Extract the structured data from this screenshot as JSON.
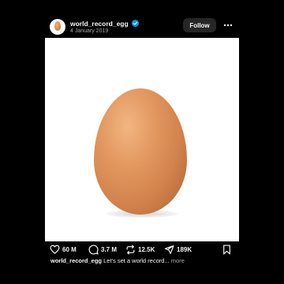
{
  "post": {
    "username": "world_record_egg",
    "date": "4 January 2019",
    "follow_label": "Follow",
    "verified": true
  },
  "icons": {
    "avatar": "egg-avatar",
    "verified": "verified-badge-icon",
    "more": "more-options-icon",
    "like": "heart-icon",
    "comment": "comment-icon",
    "repost": "repost-icon",
    "share": "send-icon",
    "save": "bookmark-icon"
  },
  "stats": {
    "likes": "60 M",
    "comments": "3.7 M",
    "reposts": "12.5K",
    "shares": "189K"
  },
  "caption": {
    "username": "world_record_egg",
    "text": "Let's set a world record...",
    "more_label": "more"
  },
  "colors": {
    "background": "#000000",
    "text": "#f5f5f5",
    "secondary_text": "#a8a8a8",
    "verified_blue": "#0095f6",
    "follow_button": "#262626"
  }
}
